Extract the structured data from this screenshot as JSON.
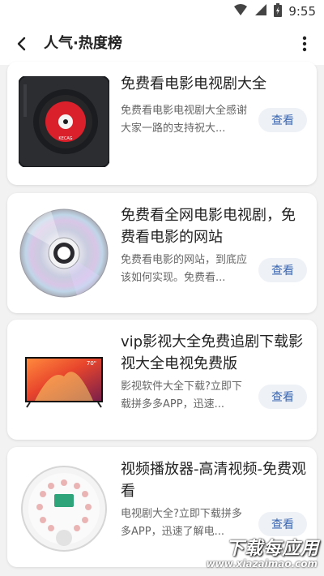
{
  "status": {
    "time": "9:55"
  },
  "header": {
    "title": "人气·热度榜"
  },
  "items": [
    {
      "title": "免费看电影电视剧大全",
      "desc": "免费看电影电视剧大全感谢大家一路的支持祝大...",
      "button": "查看",
      "image": "cd-player-icon"
    },
    {
      "title": "免费看全网电影电视剧，免费看电影的网站",
      "desc": "免费看电影的网站，到底应该如何实现。免费看...",
      "button": "查看",
      "image": "disc-icon"
    },
    {
      "title": "vip影视大全免费追剧下载影视大全电视免费版",
      "desc": "影视软件大全下载?立即下载拼多多APP，迅速...",
      "button": "查看",
      "image": "tv-icon"
    },
    {
      "title": "视频播放器-高清视频-免费观看",
      "desc": "电视剧大全?立即下载拼多多APP，迅速了解电...",
      "button": "查看",
      "image": "speaker-icon"
    }
  ],
  "tv_screen_label": "70\"",
  "watermark": {
    "text": "下载每应用",
    "url": "www.xiazaimao.com"
  },
  "colors": {
    "button_bg": "#eef1f6",
    "button_text": "#3a66b3"
  }
}
